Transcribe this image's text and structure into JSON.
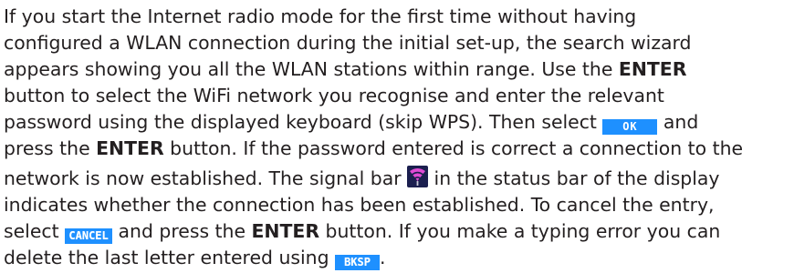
{
  "paragraph": {
    "l1": "If you start the Internet radio mode for the first time without having",
    "l2": "configured a WLAN connection during the initial set-up, the search wizard",
    "l3a": "appears showing you all the WLAN stations within range. Use the ",
    "l3b": "ENTER",
    "l4": "button to select the WiFi network you recognise and enter the relevant",
    "l5a": "password using the displayed keyboard (skip WPS). Then select ",
    "l5b": " and",
    "l6a": "press the ",
    "l6b": "ENTER",
    "l6c": " button. If the password entered is correct a connection to the",
    "l7a": "network is now established. The signal bar ",
    "l7b": " in the status bar of the display",
    "l8": "indicates whether the connection has been established. To cancel the entry,",
    "l9a": "select ",
    "l9b": " and press the ",
    "l9c": "ENTER",
    "l9d": " button. If you make a typing error you can",
    "l10a": "delete the last letter entered using ",
    "l10b": "."
  },
  "badges": {
    "ok": "OK",
    "cancel": "CANCEL",
    "bksp": "BKSP"
  },
  "icons": {
    "signal": "wifi-signal-icon"
  },
  "colors": {
    "badge_blue": "#1e90ff",
    "text": "#231f20",
    "signal_bg": "#1b1f4f",
    "signal_bars": "#e04bd4"
  }
}
